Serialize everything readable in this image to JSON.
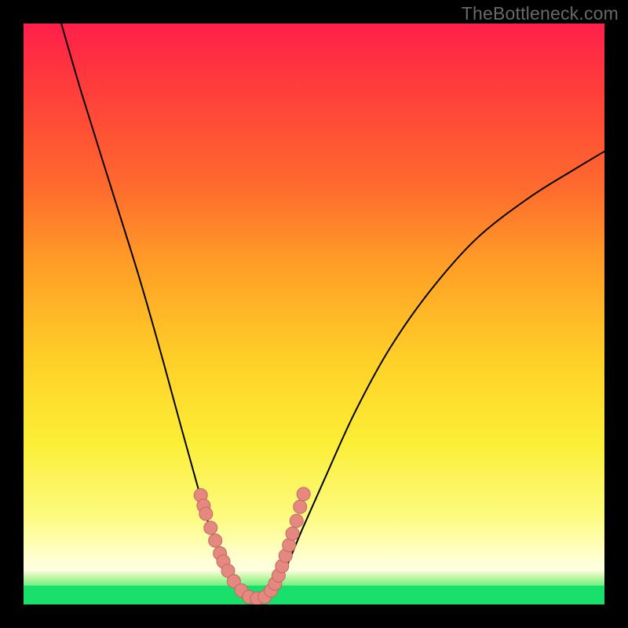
{
  "watermark": "TheBottleneck.com",
  "colors": {
    "background_border": "#000000",
    "gradient_top": "#FF1F4B",
    "gradient_bottom": "#FFFFFF",
    "green_strip": "#18E06B",
    "curve_stroke": "#000000",
    "marker_fill": "#E58880",
    "marker_stroke": "#C16A62"
  },
  "chart_data": {
    "type": "line",
    "title": "",
    "xlabel": "",
    "ylabel": "",
    "xlim": [
      0,
      100
    ],
    "ylim": [
      0,
      100
    ],
    "grid": false,
    "legend": false,
    "series": [
      {
        "name": "left-branch",
        "x": [
          6.5,
          10,
          15,
          20,
          24,
          27,
          29.5,
          31.5,
          33.5,
          35.5,
          37,
          38
        ],
        "y": [
          100,
          88,
          72,
          56,
          42,
          31,
          22,
          15,
          9,
          5,
          2,
          1
        ]
      },
      {
        "name": "valley",
        "x": [
          38,
          39,
          40.5,
          42
        ],
        "y": [
          1,
          0.5,
          0.5,
          1
        ]
      },
      {
        "name": "right-branch",
        "x": [
          42,
          43.5,
          45.5,
          48,
          52,
          57,
          63,
          70,
          78,
          87,
          95,
          100
        ],
        "y": [
          1,
          3,
          7,
          13,
          22,
          33,
          44,
          54,
          63,
          70,
          75,
          78
        ]
      }
    ],
    "markers": {
      "name": "pink-dots",
      "x": [
        30.5,
        31.0,
        31.4,
        32.2,
        33.0,
        33.8,
        34.4,
        35.2,
        36.2,
        37.5,
        38.8,
        40.2,
        41.5,
        42.6,
        43.3,
        43.9,
        44.5,
        45.1,
        45.7,
        46.3,
        47.0,
        47.6,
        48.2
      ],
      "y": [
        18.8,
        17.0,
        15.6,
        13.2,
        11.0,
        8.8,
        7.4,
        5.8,
        4.0,
        2.4,
        1.3,
        1.0,
        1.3,
        2.4,
        3.6,
        5.0,
        6.6,
        8.4,
        10.2,
        12.2,
        14.4,
        16.8,
        19.0
      ]
    }
  }
}
